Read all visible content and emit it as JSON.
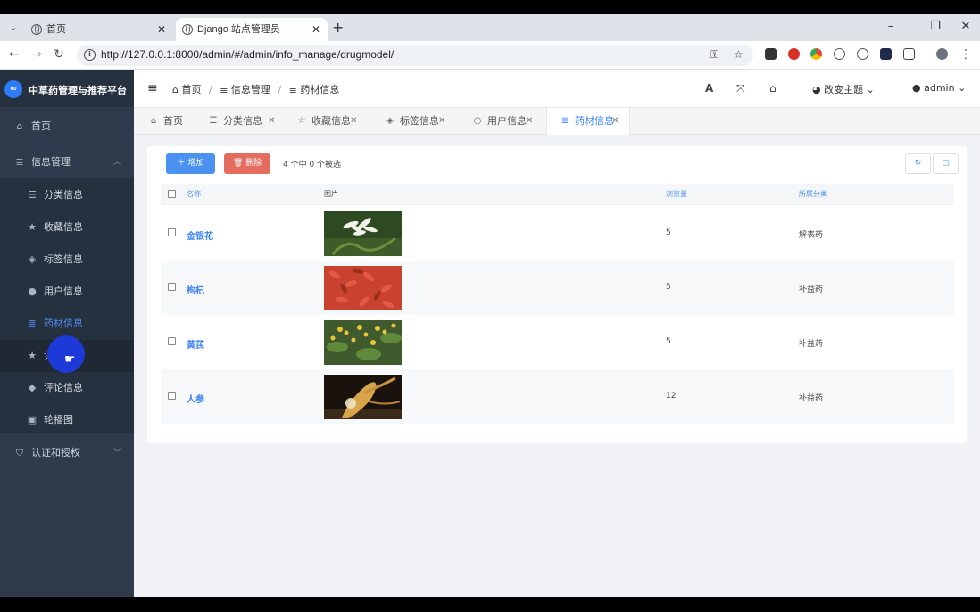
{
  "browser": {
    "tabs": [
      {
        "title": "首页"
      },
      {
        "title": "Django 站点管理员"
      }
    ],
    "url": "http://127.0.0.1:8000/admin/#/admin/info_manage/drugmodel/"
  },
  "sidebar": {
    "brand": "中草药管理与推荐平台",
    "items": [
      {
        "label": "首页"
      },
      {
        "label": "信息管理"
      },
      {
        "label": "分类信息"
      },
      {
        "label": "收藏信息"
      },
      {
        "label": "标签信息"
      },
      {
        "label": "用户信息"
      },
      {
        "label": "药材信息"
      },
      {
        "label": "评分信息"
      },
      {
        "label": "评论信息"
      },
      {
        "label": "轮播图"
      },
      {
        "label": "认证和授权"
      }
    ]
  },
  "header": {
    "breadcrumbs": [
      "首页",
      "信息管理",
      "药材信息"
    ],
    "theme_label": "改变主题",
    "user": "admin"
  },
  "page_tabs": [
    {
      "label": "首页"
    },
    {
      "label": "分类信息"
    },
    {
      "label": "收藏信息"
    },
    {
      "label": "标签信息"
    },
    {
      "label": "用户信息"
    },
    {
      "label": "药材信息"
    }
  ],
  "toolbar": {
    "add_label": "增加",
    "delete_label": "删除",
    "selection_info": "4 个中 0 个被选"
  },
  "table": {
    "columns": [
      "名称",
      "图片",
      "浏览量",
      "所属分类"
    ],
    "rows": [
      {
        "name": "金银花",
        "views": "5",
        "category": "解表药"
      },
      {
        "name": "枸杞",
        "views": "5",
        "category": "补益药"
      },
      {
        "name": "黄芪",
        "views": "5",
        "category": "补益药"
      },
      {
        "name": "人参",
        "views": "12",
        "category": "补益药"
      }
    ]
  },
  "colors": {
    "sidebar_bg": "#2f3b4c",
    "accent": "#4b92f0",
    "danger": "#e46d5f"
  }
}
